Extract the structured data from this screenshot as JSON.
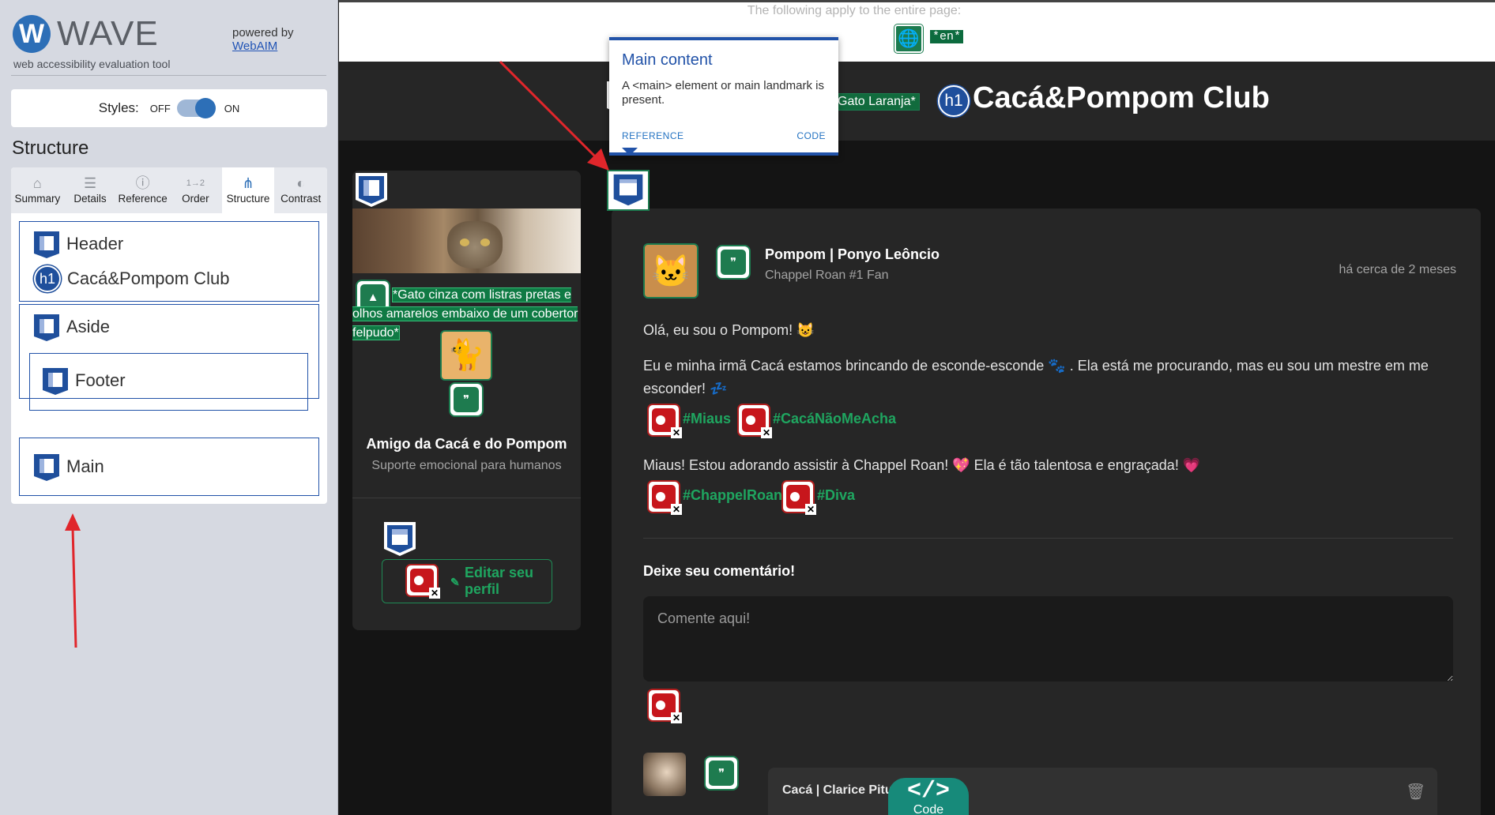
{
  "wave": {
    "logo_text": "WAVE",
    "tagline": "web accessibility evaluation tool",
    "powered_by": "powered by",
    "webaim_link": "WebAIM",
    "styles_label": "Styles:",
    "styles_off": "OFF",
    "styles_on": "ON",
    "section_title": "Structure",
    "tabs": [
      {
        "label": "Summary",
        "icon": "home-icon"
      },
      {
        "label": "Details",
        "icon": "list-icon"
      },
      {
        "label": "Reference",
        "icon": "info-icon"
      },
      {
        "label": "Order",
        "icon": "order-icon"
      },
      {
        "label": "Structure",
        "icon": "structure-icon",
        "active": true
      },
      {
        "label": "Contrast",
        "icon": "contrast-icon"
      }
    ],
    "structure": {
      "header": "Header",
      "h1_badge": "h1",
      "h1_text": "Cacá&Pompom Club",
      "aside": "Aside",
      "footer": "Footer",
      "main": "Main"
    }
  },
  "page": {
    "apply_text": "The following apply to the entire page:",
    "lang_tag": "*en*",
    "gato_tag": "Gato Laranja*",
    "h1_badge": "h1",
    "site_title": "Cacá&Pompom Club",
    "tooltip": {
      "title": "Main content",
      "body": "A <main> element or main landmark is present.",
      "reference": "REFERENCE",
      "code": "CODE"
    },
    "aside": {
      "alt_text": "*Gato cinza com listras pretas e olhos amarelos embaixo de um cobertor felpudo*",
      "profile_name": "Amigo da Cacá e do Pompom",
      "profile_sub": "Suporte emocional para humanos",
      "edit_button": "Editar seu perfil"
    },
    "post": {
      "author": "Pompom | Ponyo Leôncio",
      "author_sub": "Chappel Roan #1 Fan",
      "time": "há cerca de 2 meses",
      "p1": "Olá, eu sou o Pompom! 😺",
      "p2": "Eu e minha irmã Cacá estamos brincando de esconde-esconde 🐾 . Ela está me procurando, mas eu sou um mestre em me esconder! 💤",
      "tags1": [
        "#Miaus",
        "#CacáNãoMeAcha"
      ],
      "p3": "Miaus! Estou adorando assistir à Chappel Roan! 💖 Ela é tão talentosa e engraçada! 💗",
      "tags2": [
        "#ChappelRoan",
        "#Diva"
      ],
      "comment_title": "Deixe seu comentário!",
      "comment_placeholder": "Comente aqui!",
      "reply_author": "Cacá | Clarice Pituc"
    },
    "code_fab": {
      "glyph": "</>",
      "label": "Code"
    }
  }
}
